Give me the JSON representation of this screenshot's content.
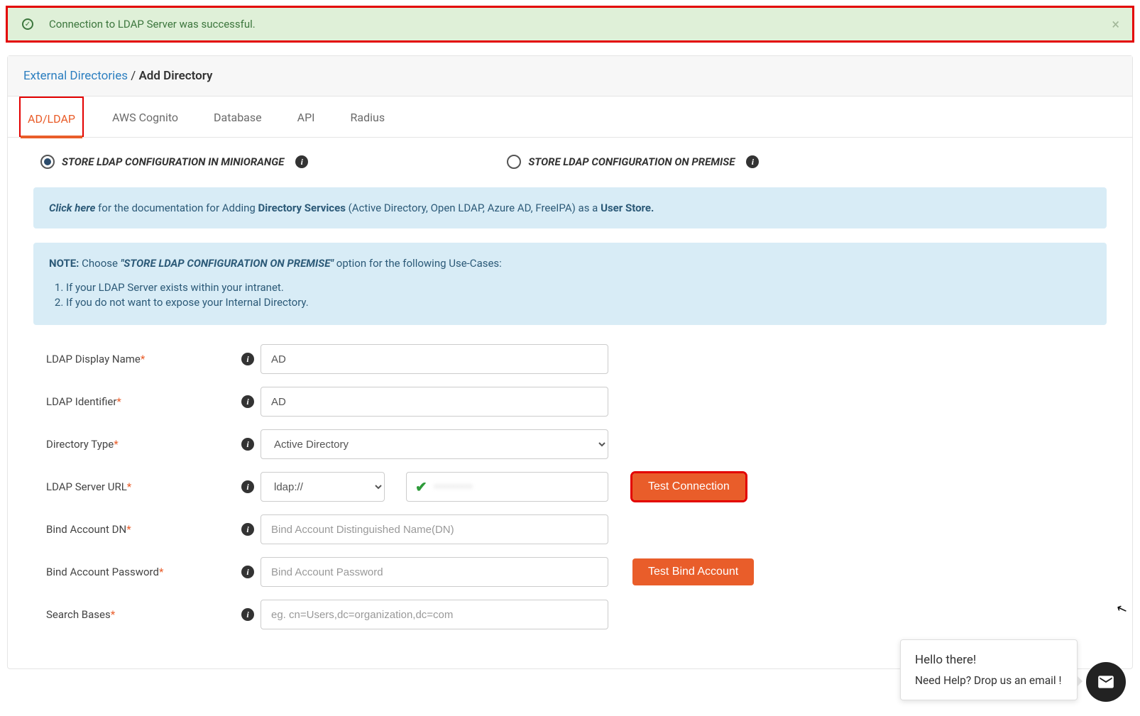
{
  "alert": {
    "message": "Connection to LDAP Server was successful.",
    "close": "×"
  },
  "breadcrumb": {
    "root": "External Directories",
    "sep": " / ",
    "current": "Add Directory"
  },
  "tabs": {
    "adldap": "AD/LDAP",
    "cognito": "AWS Cognito",
    "database": "Database",
    "api": "API",
    "radius": "Radius"
  },
  "radios": {
    "miniorange": "STORE LDAP CONFIGURATION IN MINIORANGE",
    "onpremise": "STORE LDAP CONFIGURATION ON PREMISE"
  },
  "doc_box": {
    "click": "Click here",
    "t1": " for the documentation for Adding ",
    "dirserv": "Directory Services",
    "t2": " (Active Directory, Open LDAP, Azure AD, FreeIPA) as a ",
    "userstore": "User Store."
  },
  "note_box": {
    "note_label": "NOTE:",
    "choose": "  Choose  ",
    "onprem_quote": "\"STORE LDAP CONFIGURATION ON PREMISE\"",
    "tail": " option for the following Use-Cases:",
    "li1": "If your LDAP Server exists within your intranet.",
    "li2": "If you do not want to expose your Internal Directory."
  },
  "form": {
    "display_name_label": "LDAP Display Name",
    "display_name_value": "AD",
    "identifier_label": "LDAP Identifier",
    "identifier_value": "AD",
    "dirtype_label": "Directory Type",
    "dirtype_value": "Active Directory",
    "server_url_label": "LDAP Server URL",
    "protocol_value": "ldap://",
    "server_url_value": "•••••••••",
    "bind_dn_label": "Bind Account DN",
    "bind_dn_placeholder": "Bind Account Distinguished Name(DN)",
    "bind_pw_label": "Bind Account Password",
    "bind_pw_placeholder": "Bind Account Password",
    "search_bases_label": "Search Bases",
    "search_bases_placeholder": "eg. cn=Users,dc=organization,dc=com",
    "btn_test_conn": "Test Connection",
    "btn_test_bind": "Test Bind Account"
  },
  "chat": {
    "greet": "Hello there!",
    "help": "Need Help? Drop us an email !"
  }
}
